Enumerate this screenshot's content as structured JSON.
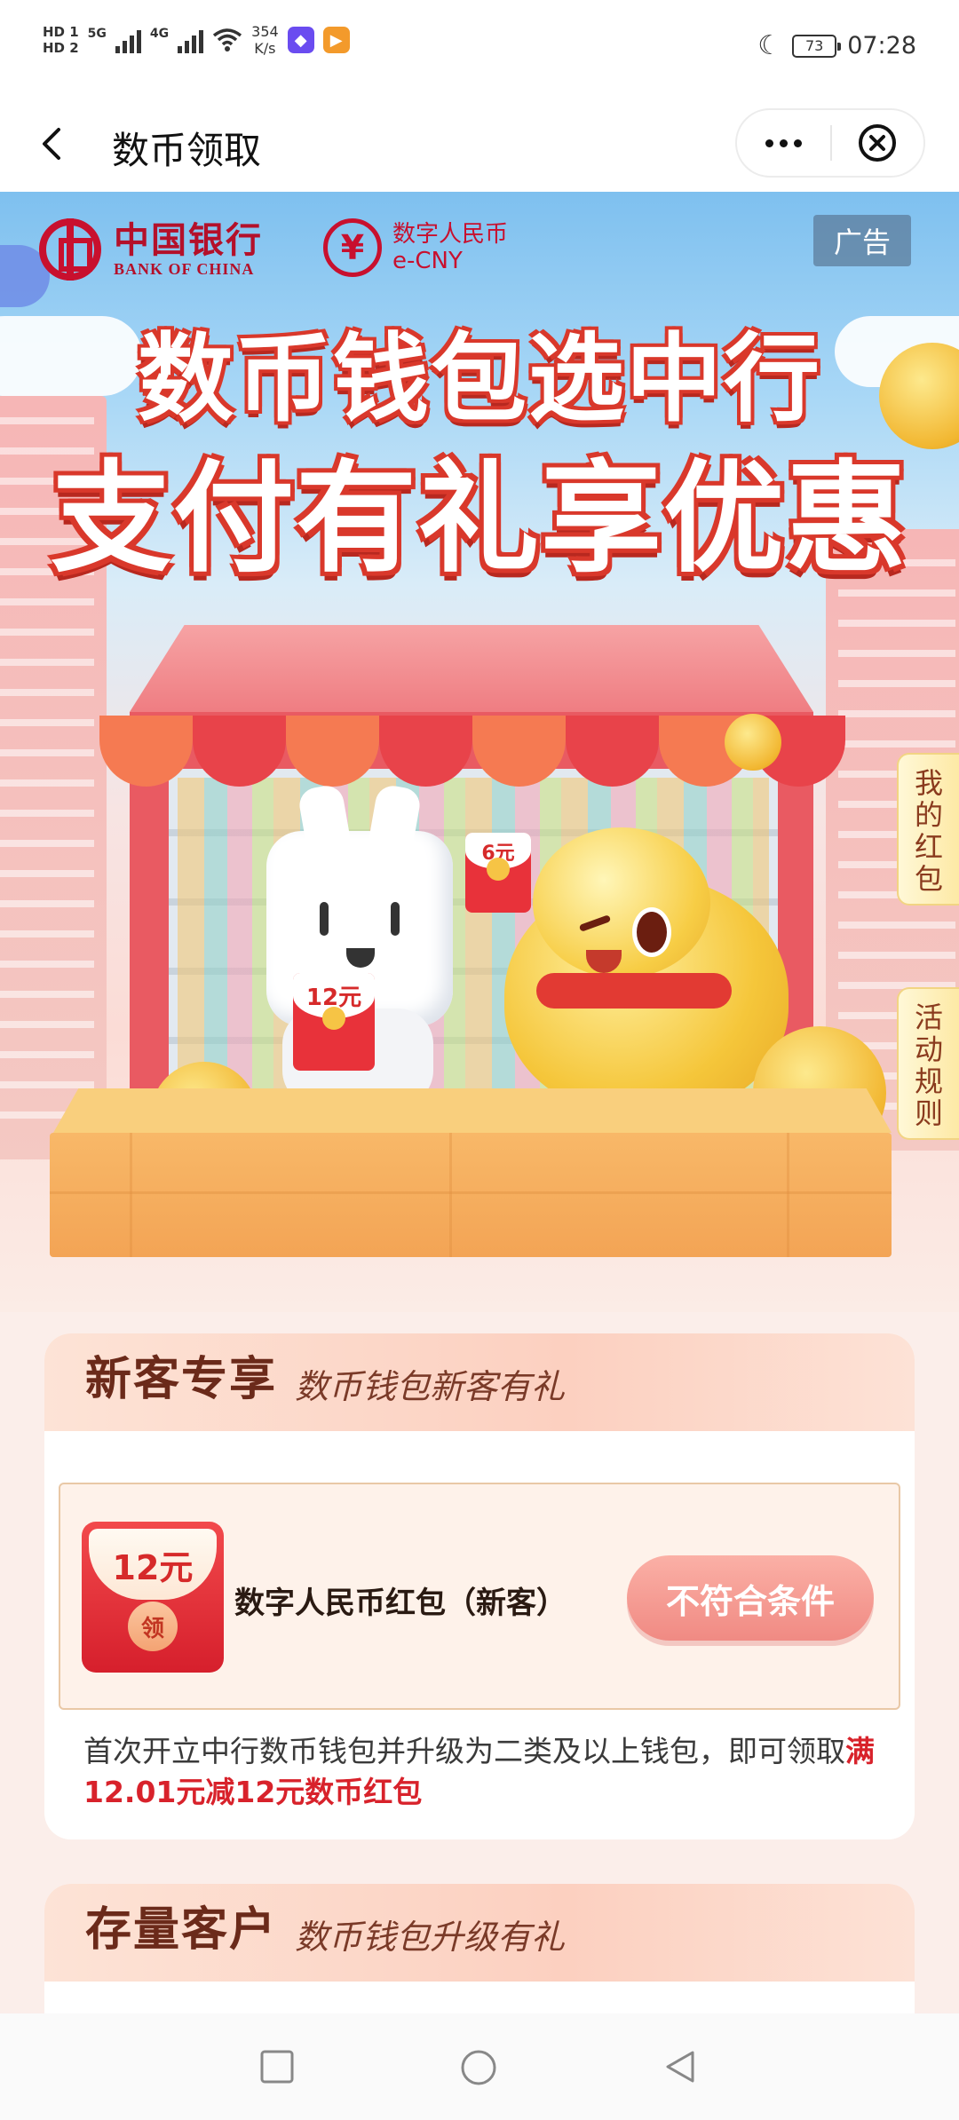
{
  "status_bar": {
    "sim1": "HD 1",
    "sim2": "HD 2",
    "net1": "5G",
    "net2": "4G",
    "speed_value": "354",
    "speed_unit": "K/s",
    "battery": "73",
    "time": "07:28"
  },
  "nav": {
    "title": "数币领取"
  },
  "banner": {
    "bank_name_cn": "中国银行",
    "bank_name_en": "BANK OF CHINA",
    "ecny_name_cn": "数字人民币",
    "ecny_name_en": "e-CNY",
    "ad_label": "广告",
    "headline_line1": "数币钱包选中行",
    "headline_line2": "支付有礼享优惠",
    "envelope_small": "6元",
    "envelope_mid": "12元",
    "side_tab_redpacket": [
      "我",
      "的",
      "红",
      "包"
    ],
    "side_tab_rules": [
      "活",
      "动",
      "规",
      "则"
    ]
  },
  "section_new": {
    "title": "新客专享",
    "subtitle": "数币钱包新客有礼",
    "coupon": {
      "amount": "12元",
      "seal": "领",
      "name": "数字人民币红包（新客）",
      "button": "不符合条件"
    },
    "desc_prefix": "首次开立中行数币钱包并升级为二类及以上钱包，即可领取",
    "desc_highlight": "满12.01元减12元数币红包"
  },
  "section_existing": {
    "title": "存量客户",
    "subtitle": "数币钱包升级有礼"
  },
  "colors": {
    "brand_red": "#c8102e",
    "highlight_red": "#d8222b",
    "button_pink": "#f08a83"
  },
  "icons": [
    "back-arrow-icon",
    "more-icon",
    "close-circle-icon",
    "moon-icon",
    "square-nav-icon",
    "circle-nav-icon",
    "triangle-back-nav-icon"
  ]
}
